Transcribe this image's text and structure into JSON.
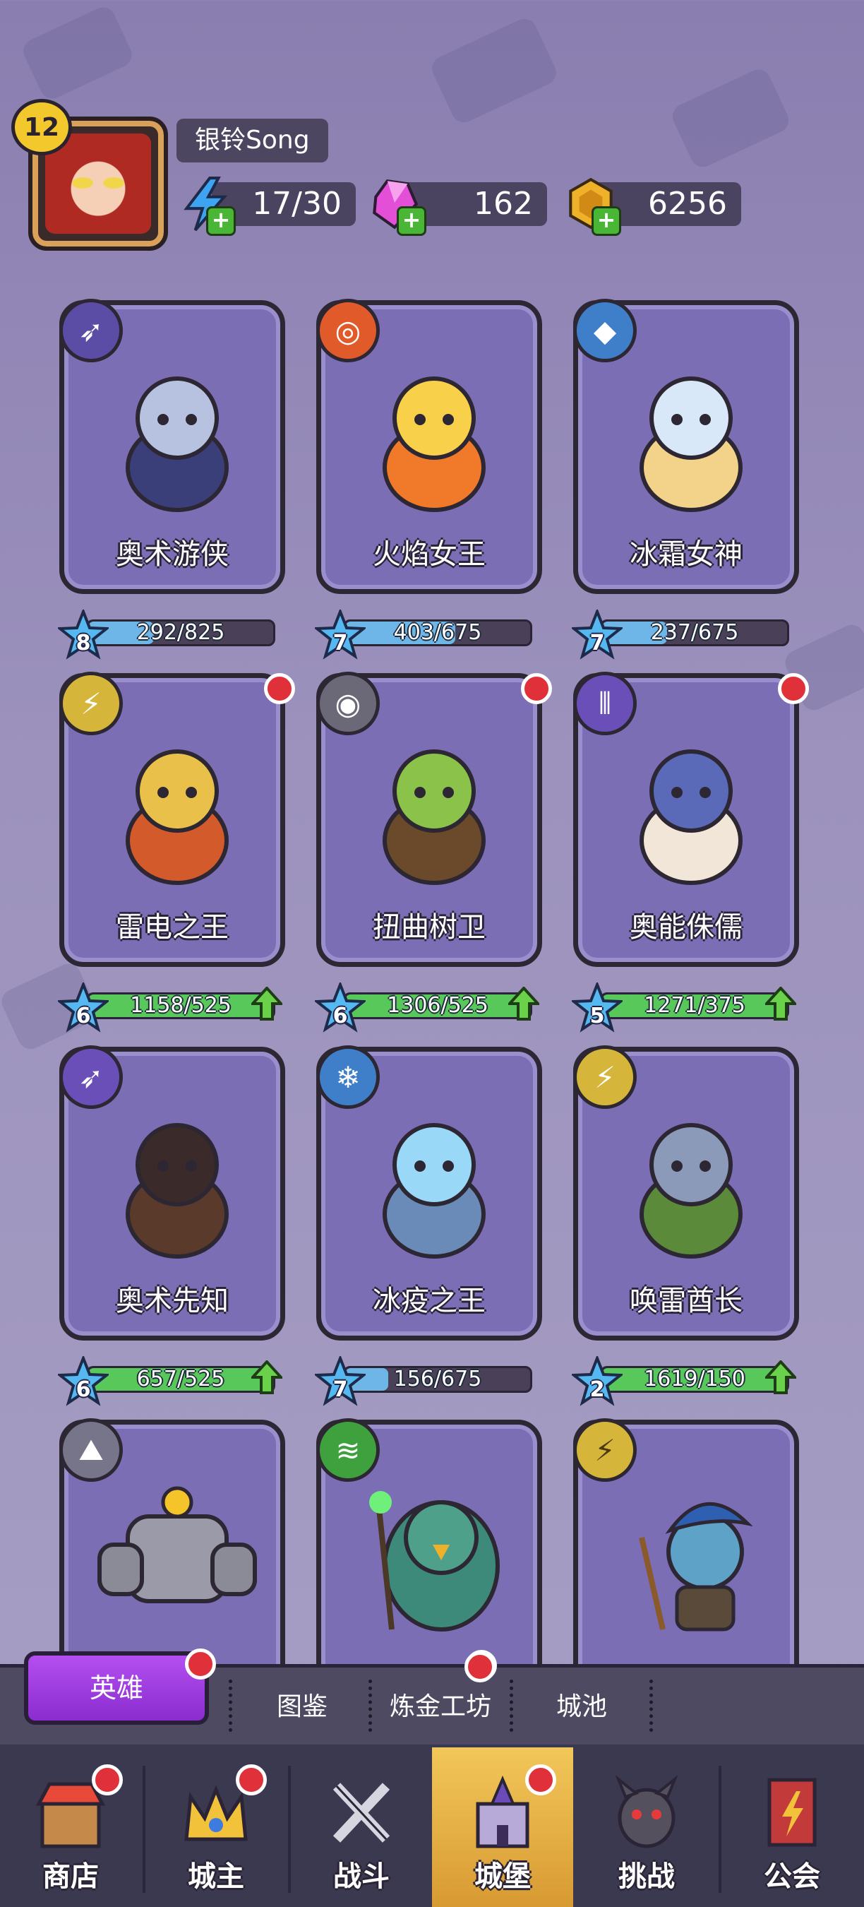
{
  "player": {
    "level": "12",
    "name": "银铃Song"
  },
  "resources": {
    "energy": "17/30",
    "gems": "162",
    "gold": "6256"
  },
  "heroes": [
    {
      "name": "奥术游侠",
      "stars": "8",
      "progress": "292/825",
      "fraction": 0.354,
      "upgrade": false,
      "alert": false
    },
    {
      "name": "火焰女王",
      "stars": "7",
      "progress": "403/675",
      "fraction": 0.597,
      "upgrade": false,
      "alert": false
    },
    {
      "name": "冰霜女神",
      "stars": "7",
      "progress": "237/675",
      "fraction": 0.351,
      "upgrade": false,
      "alert": false
    },
    {
      "name": "雷电之王",
      "stars": "6",
      "progress": "1158/525",
      "fraction": 1.0,
      "upgrade": true,
      "alert": true
    },
    {
      "name": "扭曲树卫",
      "stars": "6",
      "progress": "1306/525",
      "fraction": 1.0,
      "upgrade": true,
      "alert": true
    },
    {
      "name": "奥能侏儒",
      "stars": "5",
      "progress": "1271/375",
      "fraction": 1.0,
      "upgrade": true,
      "alert": true
    },
    {
      "name": "奥术先知",
      "stars": "6",
      "progress": "657/525",
      "fraction": 1.0,
      "upgrade": true,
      "alert": false
    },
    {
      "name": "冰疫之王",
      "stars": "7",
      "progress": "156/675",
      "fraction": 0.231,
      "upgrade": false,
      "alert": false
    },
    {
      "name": "唤雷酋长",
      "stars": "2",
      "progress": "1619/150",
      "fraction": 1.0,
      "upgrade": true,
      "alert": false
    }
  ],
  "subtabs": {
    "active": "英雄",
    "items": [
      "图鉴",
      "炼金工坊",
      "城池"
    ]
  },
  "nav": [
    "商店",
    "城主",
    "战斗",
    "城堡",
    "挑战",
    "公会"
  ],
  "colors": {
    "card": "#7b6eb5",
    "progress_blue": "#6fb6e8",
    "progress_green": "#58c85a",
    "alert": "#e0303a",
    "nav_active": "#f2c75a"
  }
}
